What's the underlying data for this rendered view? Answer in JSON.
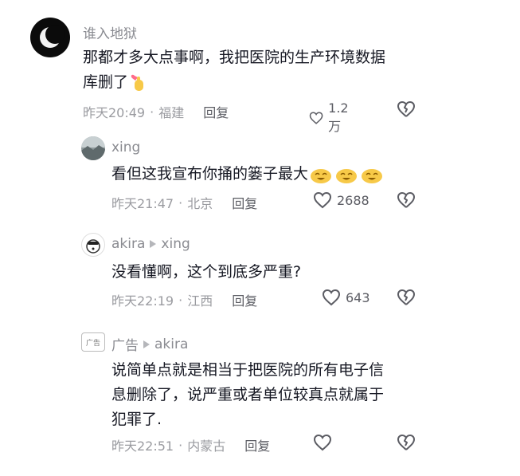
{
  "comments": [
    {
      "user": "谁入地狱",
      "text_line1": "那都才多大点事啊，我把医院的生产环境数据",
      "text_line2": "库删了",
      "emoji": "finger-heart",
      "time": "昨天20:49",
      "location": "福建",
      "reply_label": "回复",
      "likes": "1.2万"
    },
    {
      "user": "xing",
      "text": "看但这我宣布你捅的篓子最大",
      "emoji": "laughing-cat x3",
      "time": "昨天21:47",
      "location": "北京",
      "reply_label": "回复",
      "likes": "2688"
    },
    {
      "user": "akira",
      "reply_to": "xing",
      "text": "没看懂啊，这个到底多严重?",
      "time": "昨天22:19",
      "location": "江西",
      "reply_label": "回复",
      "likes": "643"
    },
    {
      "user": "广告",
      "reply_to": "akira",
      "avatar_text": "广告",
      "text_line1": "说简单点就是相当于把医院的所有电子信",
      "text_line2": "息删除了，说严重或者单位较真点就属于",
      "text_line3": "犯罪了.",
      "time": "昨天22:51",
      "location": "内蒙古",
      "reply_label": "回复",
      "likes": ""
    }
  ],
  "separator": "·"
}
